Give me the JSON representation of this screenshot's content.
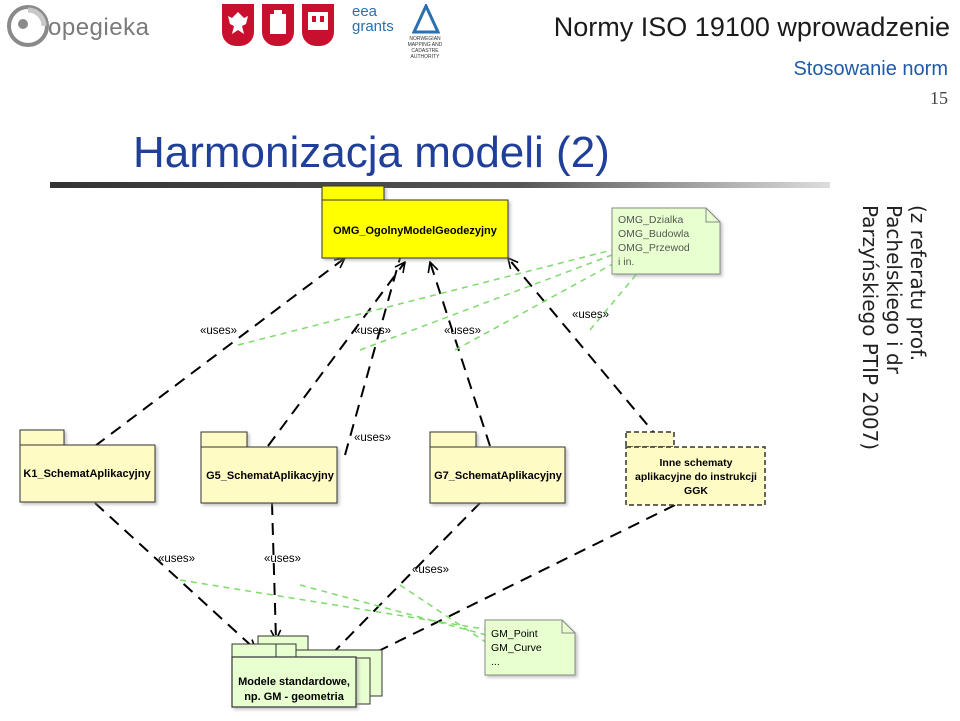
{
  "header": {
    "logo_text": "opegieka",
    "eea_text": "eea grants",
    "norway_text": "NORWEGIAN MAPPING AND CADASTRE AUTHORITY",
    "deck_title": "Normy ISO 19100 wprowadzenie",
    "section": "Stosowanie norm",
    "page_number": "15"
  },
  "slide": {
    "title": "Harmonizacja modeli (2)",
    "credit": "(z referatu prof. Pachelskiego i dr Parzyńskiego PTIP 2007)"
  },
  "diagram": {
    "packages": {
      "omg": "OMG_OgolnyModelGeodezyjny",
      "k1": "K1_SchematAplikacyjny",
      "g5": "G5_SchematAplikacyjny",
      "g7": "G7_SchematAplikacyjny",
      "inne": [
        "Inne schematy",
        "aplikacyjne do instrukcji",
        "GGK"
      ],
      "gm": [
        "Modele standardowe,",
        "np. GM - geometria"
      ]
    },
    "notes": {
      "omg_note": [
        "OMG_Dzialka",
        "OMG_Budowla",
        "OMG_Przewod",
        "i in."
      ],
      "gm_note": [
        "GM_Point",
        "GM_Curve",
        "..."
      ]
    },
    "uses_label": "«uses»"
  },
  "colors": {
    "package_fill": "#fffbc4",
    "omg_fill": "#ffff00",
    "note_fill": "#e8ffd0",
    "dependency": "#000000",
    "note_link": "#7ddc6a",
    "title": "#1f3f99",
    "section": "#1f5aa6"
  }
}
